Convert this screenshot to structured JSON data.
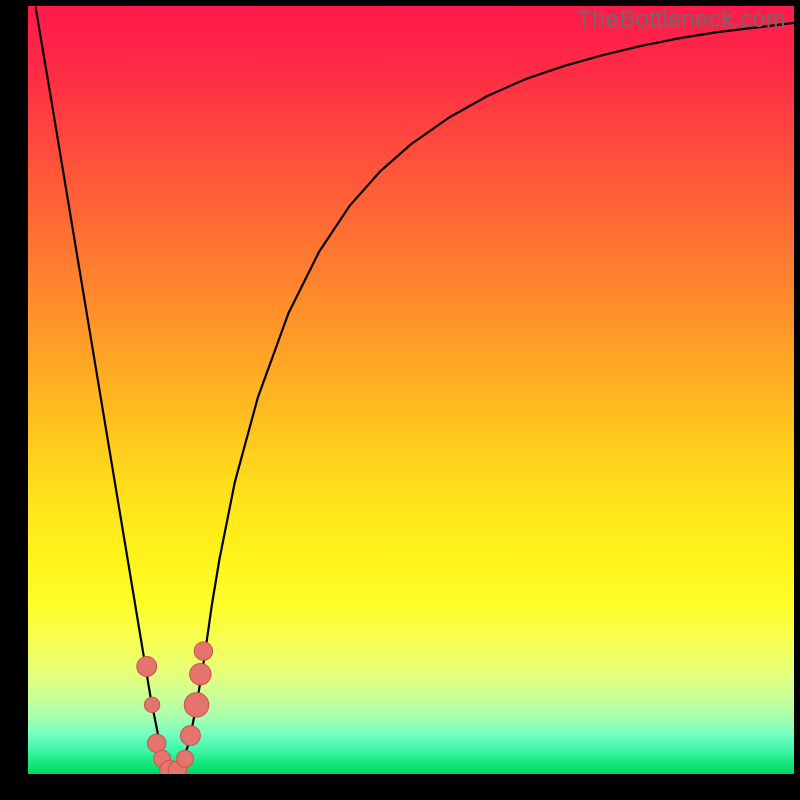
{
  "attribution": "TheBottleneck.com",
  "colors": {
    "curve_stroke": "#000000",
    "marker_fill": "#e5736e",
    "marker_stroke": "#c9544f",
    "background_top": "#ff1a4b",
    "background_bottom": "#00d860"
  },
  "chart_data": {
    "type": "line",
    "title": "",
    "xlabel": "",
    "ylabel": "",
    "xlim": [
      0,
      100
    ],
    "ylim": [
      0,
      100
    ],
    "yaxis_inverted_visual": true,
    "series": [
      {
        "name": "bottleneck-curve",
        "x": [
          1.0,
          3,
          5,
          7,
          9,
          11,
          13,
          15,
          16,
          17,
          18,
          19,
          20,
          21,
          22,
          23,
          24,
          25,
          27,
          30,
          34,
          38,
          42,
          46,
          50,
          55,
          60,
          65,
          70,
          75,
          80,
          85,
          90,
          95,
          100
        ],
        "y": [
          100,
          88,
          76,
          64,
          52,
          40,
          28,
          16,
          10,
          5,
          1.5,
          0.2,
          1.2,
          4,
          9,
          15,
          22,
          28,
          38,
          49,
          60,
          68,
          74,
          78.5,
          82,
          85.5,
          88.3,
          90.5,
          92.2,
          93.6,
          94.8,
          95.8,
          96.6,
          97.2,
          97.8
        ]
      }
    ],
    "markers": [
      {
        "x": 15.5,
        "y": 14,
        "r": 1.3
      },
      {
        "x": 16.2,
        "y": 9,
        "r": 1.0
      },
      {
        "x": 16.8,
        "y": 4,
        "r": 1.2
      },
      {
        "x": 17.5,
        "y": 2,
        "r": 1.1
      },
      {
        "x": 18.5,
        "y": 0.5,
        "r": 1.3
      },
      {
        "x": 19.5,
        "y": 0.5,
        "r": 1.2
      },
      {
        "x": 20.5,
        "y": 2,
        "r": 1.1
      },
      {
        "x": 21.2,
        "y": 5,
        "r": 1.3
      },
      {
        "x": 22.0,
        "y": 9,
        "r": 1.6
      },
      {
        "x": 22.5,
        "y": 13,
        "r": 1.4
      },
      {
        "x": 22.9,
        "y": 16,
        "r": 1.2
      }
    ],
    "gradient_note": "Background vertical gradient encodes value quality: red=bad (high bottleneck), green=good (low bottleneck). Curve minimum ≈ x 19."
  }
}
